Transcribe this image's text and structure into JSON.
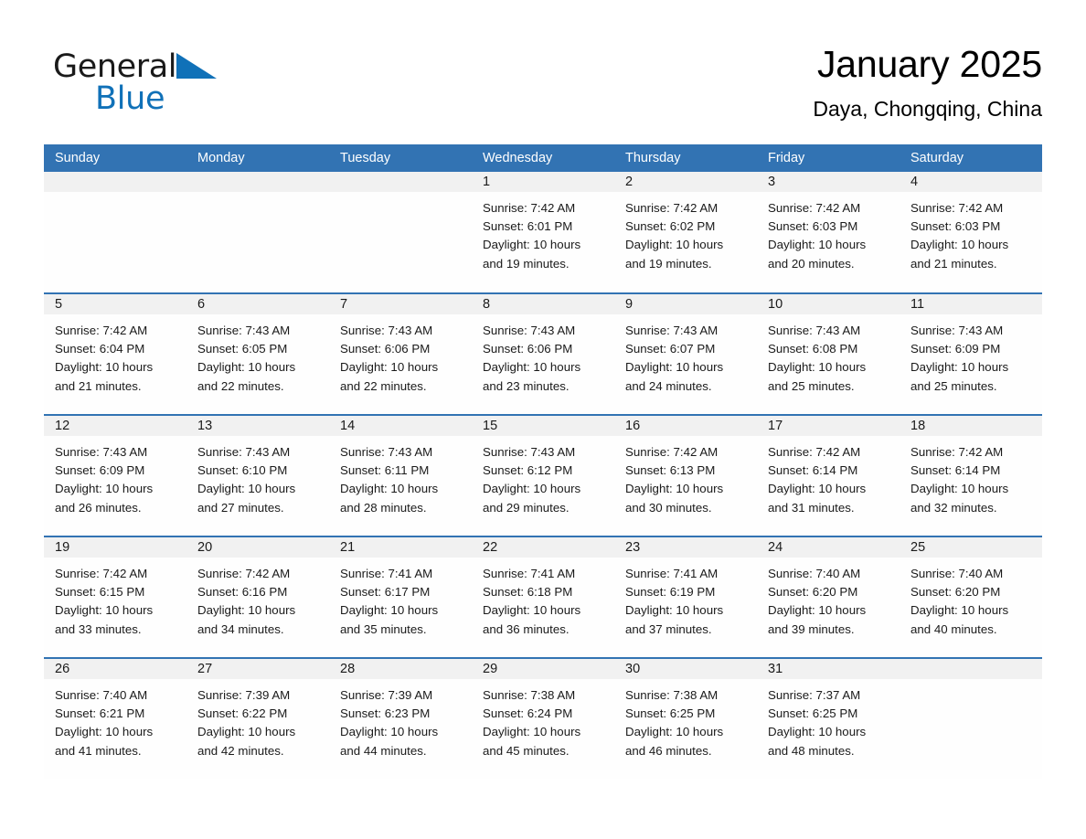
{
  "brand": {
    "name_part1": "General",
    "name_part2": "Blue",
    "triangle_color": "#1071b8"
  },
  "header": {
    "title": "January 2025",
    "location": "Daya, Chongqing, China"
  },
  "theme": {
    "header_blue": "#3273b3",
    "day_band_gray": "#f1f1f1",
    "text_black": "#1a1a1a",
    "brand_blue": "#1071b8"
  },
  "calendar": {
    "day_names": [
      "Sunday",
      "Monday",
      "Tuesday",
      "Wednesday",
      "Thursday",
      "Friday",
      "Saturday"
    ],
    "weeks": [
      [
        {
          "day": "",
          "sunrise": "",
          "sunset": "",
          "daylight_line1": "",
          "daylight_line2": ""
        },
        {
          "day": "",
          "sunrise": "",
          "sunset": "",
          "daylight_line1": "",
          "daylight_line2": ""
        },
        {
          "day": "",
          "sunrise": "",
          "sunset": "",
          "daylight_line1": "",
          "daylight_line2": ""
        },
        {
          "day": "1",
          "sunrise": "Sunrise: 7:42 AM",
          "sunset": "Sunset: 6:01 PM",
          "daylight_line1": "Daylight: 10 hours",
          "daylight_line2": "and 19 minutes."
        },
        {
          "day": "2",
          "sunrise": "Sunrise: 7:42 AM",
          "sunset": "Sunset: 6:02 PM",
          "daylight_line1": "Daylight: 10 hours",
          "daylight_line2": "and 19 minutes."
        },
        {
          "day": "3",
          "sunrise": "Sunrise: 7:42 AM",
          "sunset": "Sunset: 6:03 PM",
          "daylight_line1": "Daylight: 10 hours",
          "daylight_line2": "and 20 minutes."
        },
        {
          "day": "4",
          "sunrise": "Sunrise: 7:42 AM",
          "sunset": "Sunset: 6:03 PM",
          "daylight_line1": "Daylight: 10 hours",
          "daylight_line2": "and 21 minutes."
        }
      ],
      [
        {
          "day": "5",
          "sunrise": "Sunrise: 7:42 AM",
          "sunset": "Sunset: 6:04 PM",
          "daylight_line1": "Daylight: 10 hours",
          "daylight_line2": "and 21 minutes."
        },
        {
          "day": "6",
          "sunrise": "Sunrise: 7:43 AM",
          "sunset": "Sunset: 6:05 PM",
          "daylight_line1": "Daylight: 10 hours",
          "daylight_line2": "and 22 minutes."
        },
        {
          "day": "7",
          "sunrise": "Sunrise: 7:43 AM",
          "sunset": "Sunset: 6:06 PM",
          "daylight_line1": "Daylight: 10 hours",
          "daylight_line2": "and 22 minutes."
        },
        {
          "day": "8",
          "sunrise": "Sunrise: 7:43 AM",
          "sunset": "Sunset: 6:06 PM",
          "daylight_line1": "Daylight: 10 hours",
          "daylight_line2": "and 23 minutes."
        },
        {
          "day": "9",
          "sunrise": "Sunrise: 7:43 AM",
          "sunset": "Sunset: 6:07 PM",
          "daylight_line1": "Daylight: 10 hours",
          "daylight_line2": "and 24 minutes."
        },
        {
          "day": "10",
          "sunrise": "Sunrise: 7:43 AM",
          "sunset": "Sunset: 6:08 PM",
          "daylight_line1": "Daylight: 10 hours",
          "daylight_line2": "and 25 minutes."
        },
        {
          "day": "11",
          "sunrise": "Sunrise: 7:43 AM",
          "sunset": "Sunset: 6:09 PM",
          "daylight_line1": "Daylight: 10 hours",
          "daylight_line2": "and 25 minutes."
        }
      ],
      [
        {
          "day": "12",
          "sunrise": "Sunrise: 7:43 AM",
          "sunset": "Sunset: 6:09 PM",
          "daylight_line1": "Daylight: 10 hours",
          "daylight_line2": "and 26 minutes."
        },
        {
          "day": "13",
          "sunrise": "Sunrise: 7:43 AM",
          "sunset": "Sunset: 6:10 PM",
          "daylight_line1": "Daylight: 10 hours",
          "daylight_line2": "and 27 minutes."
        },
        {
          "day": "14",
          "sunrise": "Sunrise: 7:43 AM",
          "sunset": "Sunset: 6:11 PM",
          "daylight_line1": "Daylight: 10 hours",
          "daylight_line2": "and 28 minutes."
        },
        {
          "day": "15",
          "sunrise": "Sunrise: 7:43 AM",
          "sunset": "Sunset: 6:12 PM",
          "daylight_line1": "Daylight: 10 hours",
          "daylight_line2": "and 29 minutes."
        },
        {
          "day": "16",
          "sunrise": "Sunrise: 7:42 AM",
          "sunset": "Sunset: 6:13 PM",
          "daylight_line1": "Daylight: 10 hours",
          "daylight_line2": "and 30 minutes."
        },
        {
          "day": "17",
          "sunrise": "Sunrise: 7:42 AM",
          "sunset": "Sunset: 6:14 PM",
          "daylight_line1": "Daylight: 10 hours",
          "daylight_line2": "and 31 minutes."
        },
        {
          "day": "18",
          "sunrise": "Sunrise: 7:42 AM",
          "sunset": "Sunset: 6:14 PM",
          "daylight_line1": "Daylight: 10 hours",
          "daylight_line2": "and 32 minutes."
        }
      ],
      [
        {
          "day": "19",
          "sunrise": "Sunrise: 7:42 AM",
          "sunset": "Sunset: 6:15 PM",
          "daylight_line1": "Daylight: 10 hours",
          "daylight_line2": "and 33 minutes."
        },
        {
          "day": "20",
          "sunrise": "Sunrise: 7:42 AM",
          "sunset": "Sunset: 6:16 PM",
          "daylight_line1": "Daylight: 10 hours",
          "daylight_line2": "and 34 minutes."
        },
        {
          "day": "21",
          "sunrise": "Sunrise: 7:41 AM",
          "sunset": "Sunset: 6:17 PM",
          "daylight_line1": "Daylight: 10 hours",
          "daylight_line2": "and 35 minutes."
        },
        {
          "day": "22",
          "sunrise": "Sunrise: 7:41 AM",
          "sunset": "Sunset: 6:18 PM",
          "daylight_line1": "Daylight: 10 hours",
          "daylight_line2": "and 36 minutes."
        },
        {
          "day": "23",
          "sunrise": "Sunrise: 7:41 AM",
          "sunset": "Sunset: 6:19 PM",
          "daylight_line1": "Daylight: 10 hours",
          "daylight_line2": "and 37 minutes."
        },
        {
          "day": "24",
          "sunrise": "Sunrise: 7:40 AM",
          "sunset": "Sunset: 6:20 PM",
          "daylight_line1": "Daylight: 10 hours",
          "daylight_line2": "and 39 minutes."
        },
        {
          "day": "25",
          "sunrise": "Sunrise: 7:40 AM",
          "sunset": "Sunset: 6:20 PM",
          "daylight_line1": "Daylight: 10 hours",
          "daylight_line2": "and 40 minutes."
        }
      ],
      [
        {
          "day": "26",
          "sunrise": "Sunrise: 7:40 AM",
          "sunset": "Sunset: 6:21 PM",
          "daylight_line1": "Daylight: 10 hours",
          "daylight_line2": "and 41 minutes."
        },
        {
          "day": "27",
          "sunrise": "Sunrise: 7:39 AM",
          "sunset": "Sunset: 6:22 PM",
          "daylight_line1": "Daylight: 10 hours",
          "daylight_line2": "and 42 minutes."
        },
        {
          "day": "28",
          "sunrise": "Sunrise: 7:39 AM",
          "sunset": "Sunset: 6:23 PM",
          "daylight_line1": "Daylight: 10 hours",
          "daylight_line2": "and 44 minutes."
        },
        {
          "day": "29",
          "sunrise": "Sunrise: 7:38 AM",
          "sunset": "Sunset: 6:24 PM",
          "daylight_line1": "Daylight: 10 hours",
          "daylight_line2": "and 45 minutes."
        },
        {
          "day": "30",
          "sunrise": "Sunrise: 7:38 AM",
          "sunset": "Sunset: 6:25 PM",
          "daylight_line1": "Daylight: 10 hours",
          "daylight_line2": "and 46 minutes."
        },
        {
          "day": "31",
          "sunrise": "Sunrise: 7:37 AM",
          "sunset": "Sunset: 6:25 PM",
          "daylight_line1": "Daylight: 10 hours",
          "daylight_line2": "and 48 minutes."
        },
        {
          "day": "",
          "sunrise": "",
          "sunset": "",
          "daylight_line1": "",
          "daylight_line2": ""
        }
      ]
    ]
  }
}
